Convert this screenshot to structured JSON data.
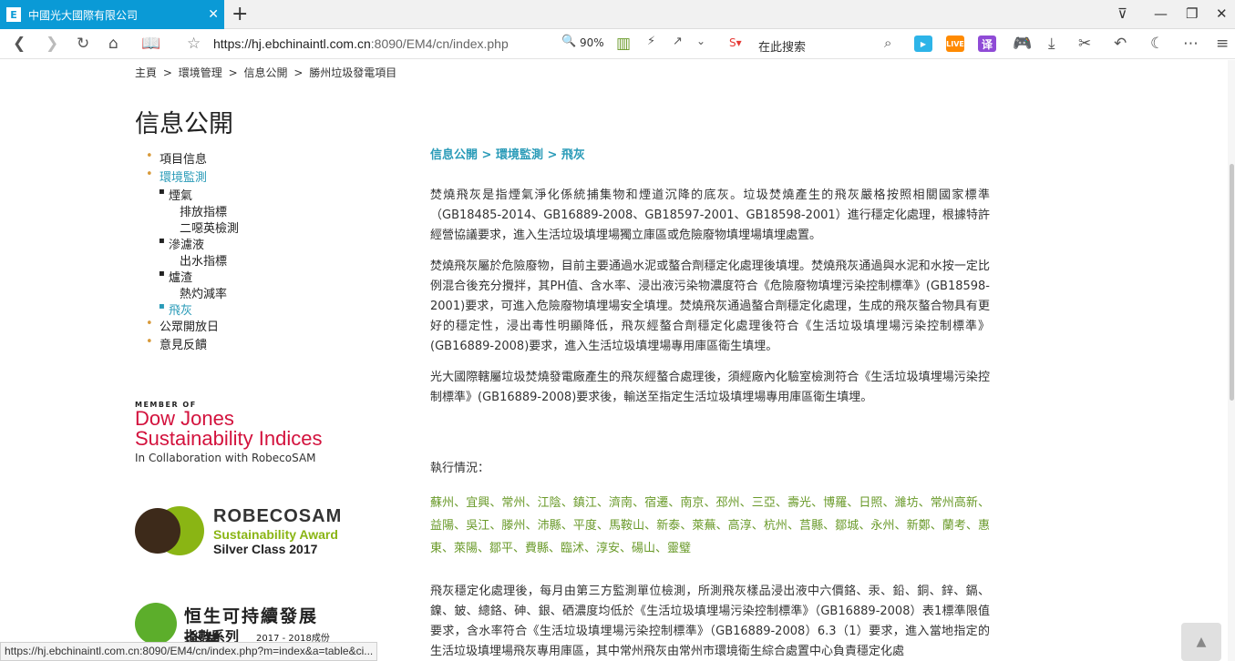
{
  "browser": {
    "tab_title": "中國光大國際有限公司",
    "tab_favicon": "E",
    "url_main": "https://hj.ebchinaintl.com.cn",
    "url_rest": ":8090/EM4/cn/index.php",
    "zoom": "90%",
    "search_placeholder": "在此搜索",
    "ext_live": "LIVE",
    "ext_translate": "译"
  },
  "breadcrumb": [
    "主頁",
    ">",
    "環境管理",
    ">",
    "信息公開",
    ">",
    "勝州垃圾發電項目"
  ],
  "sidebar": {
    "title": "信息公開",
    "items": [
      {
        "label": "項目信息",
        "level": 1
      },
      {
        "label": "環境監測",
        "level": 1,
        "active": true
      },
      {
        "label": "煙氣",
        "level": 2
      },
      {
        "label": "排放指標",
        "level": 3
      },
      {
        "label": "二噁英檢測",
        "level": 3
      },
      {
        "label": "滲濾液",
        "level": 2
      },
      {
        "label": "出水指標",
        "level": 3
      },
      {
        "label": "爐渣",
        "level": 2
      },
      {
        "label": "熱灼減率",
        "level": 3
      },
      {
        "label": "飛灰",
        "level": 2,
        "active": true
      },
      {
        "label": "公眾開放日",
        "level": 1
      },
      {
        "label": "意見反饋",
        "level": 1
      }
    ]
  },
  "logos": {
    "dj_member": "MEMBER OF",
    "dj_line1": "Dow Jones",
    "dj_line2": "Sustainability Indices",
    "dj_collab": "In Collaboration with RobecoSAM",
    "rs_line1": "ROBECOSAM",
    "rs_line2": "Sustainability Award",
    "rs_line3": "Silver Class 2017",
    "hs_line1": "恒生可持續發展企業",
    "hs_line2": "指數系列",
    "hs_line3": "2017 - 2018成份股"
  },
  "content": {
    "crumb": "信息公開 > 環境監測 > 飛灰",
    "para1": "焚燒飛灰是指煙氣淨化係統捕集物和煙道沉降的底灰。垃圾焚燒產生的飛灰嚴格按照相關國家標準（GB18485-2014、GB16889-2008、GB18597-2001、GB18598-2001）進行穩定化處理，根據特許經營協議要求，進入生活垃圾填埋場獨立庫區或危險廢物填埋場填埋處置。",
    "para2": "焚燒飛灰屬於危險廢物，目前主要通過水泥或螯合劑穩定化處理後填埋。焚燒飛灰通過與水泥和水按一定比例混合後充分攪拌，其PH值、含水率、浸出液污染物濃度符合《危險廢物填埋污染控制標準》(GB18598-2001)要求，可進入危險廢物填埋場安全填埋。焚燒飛灰通過螯合劑穩定化處理，生成的飛灰螯合物具有更好的穩定性，浸出毒性明顯降低，飛灰經螯合劑穩定化處理後符合《生活垃圾填埋場污染控制標準》(GB16889-2008)要求，進入生活垃圾填埋場專用庫區衛生填埋。",
    "para3": "光大國際轄屬垃圾焚燒發電廠產生的飛灰經螯合處理後，須經廠內化驗室檢測符合《生活垃圾填埋場污染控制標準》(GB16889-2008)要求後，輸送至指定生活垃圾填埋場專用庫區衛生填埋。",
    "exec_label": "執行情況：",
    "cities": "蘇州、宜興、常州、江陰、鎮江、濟南、宿遷、南京、邳州、三亞、壽光、博羅、日照、濰坊、常州高新、益陽、吳江、滕州、沛縣、平度、馬鞍山、新泰、萊蕪、高淳、杭州、莒縣、鄒城、永州、新鄭、蘭考、惠東、萊陽、鄒平、費縣、臨沭、淳安、碭山、靈璧",
    "para4": "飛灰穩定化處理後，每月由第三方監測單位檢測，所測飛灰樣品浸出液中六價鉻、汞、鉛、銅、鋅、鎘、鎳、鈹、總鉻、砷、銀、硒濃度均低於《生活垃圾填埋場污染控制標準》（GB16889-2008）表1標準限值要求，含水率符合《生活垃圾填埋場污染控制標準》（GB16889-2008）6.3（1）要求，進入當地指定的生活垃圾填埋場飛灰專用庫區，其中常州飛灰由常州市環境衛生綜合處置中心負責穩定化處"
  },
  "status_url": "https://hj.ebchinaintl.com.cn:8090/EM4/cn/index.php?m=index&a=table&ci..."
}
